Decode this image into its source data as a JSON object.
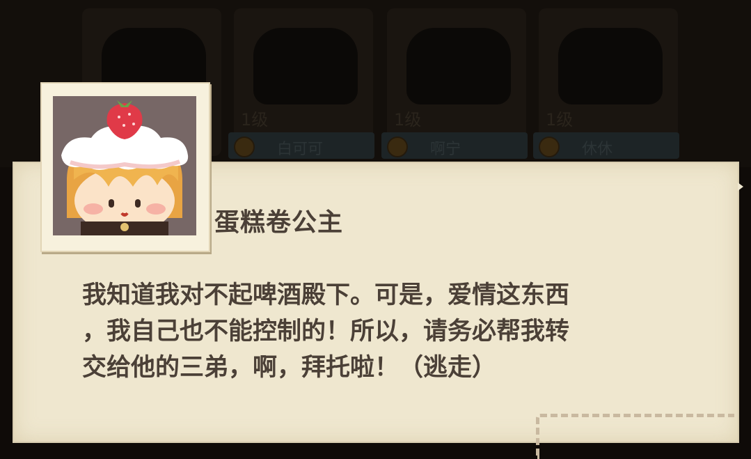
{
  "background_roster": [
    {
      "level": "",
      "name": ""
    },
    {
      "level": "1级",
      "name": "白可可"
    },
    {
      "level": "1级",
      "name": "啊宁"
    },
    {
      "level": "1级",
      "name": "休休"
    }
  ],
  "speaker": {
    "name": "蛋糕卷公主",
    "portrait_icon": "cake-roll-princess-icon"
  },
  "dialog": {
    "text": "我知道我对不起啤酒殿下。可是，爱情这东西\n，我自己也不能控制的！所以，请务必帮我转\n交给他的三弟，啊，拜托啦！（逃走）"
  },
  "colors": {
    "panel": "#efe7cf",
    "text": "#4b4037",
    "overlay": "#0f0b08"
  }
}
